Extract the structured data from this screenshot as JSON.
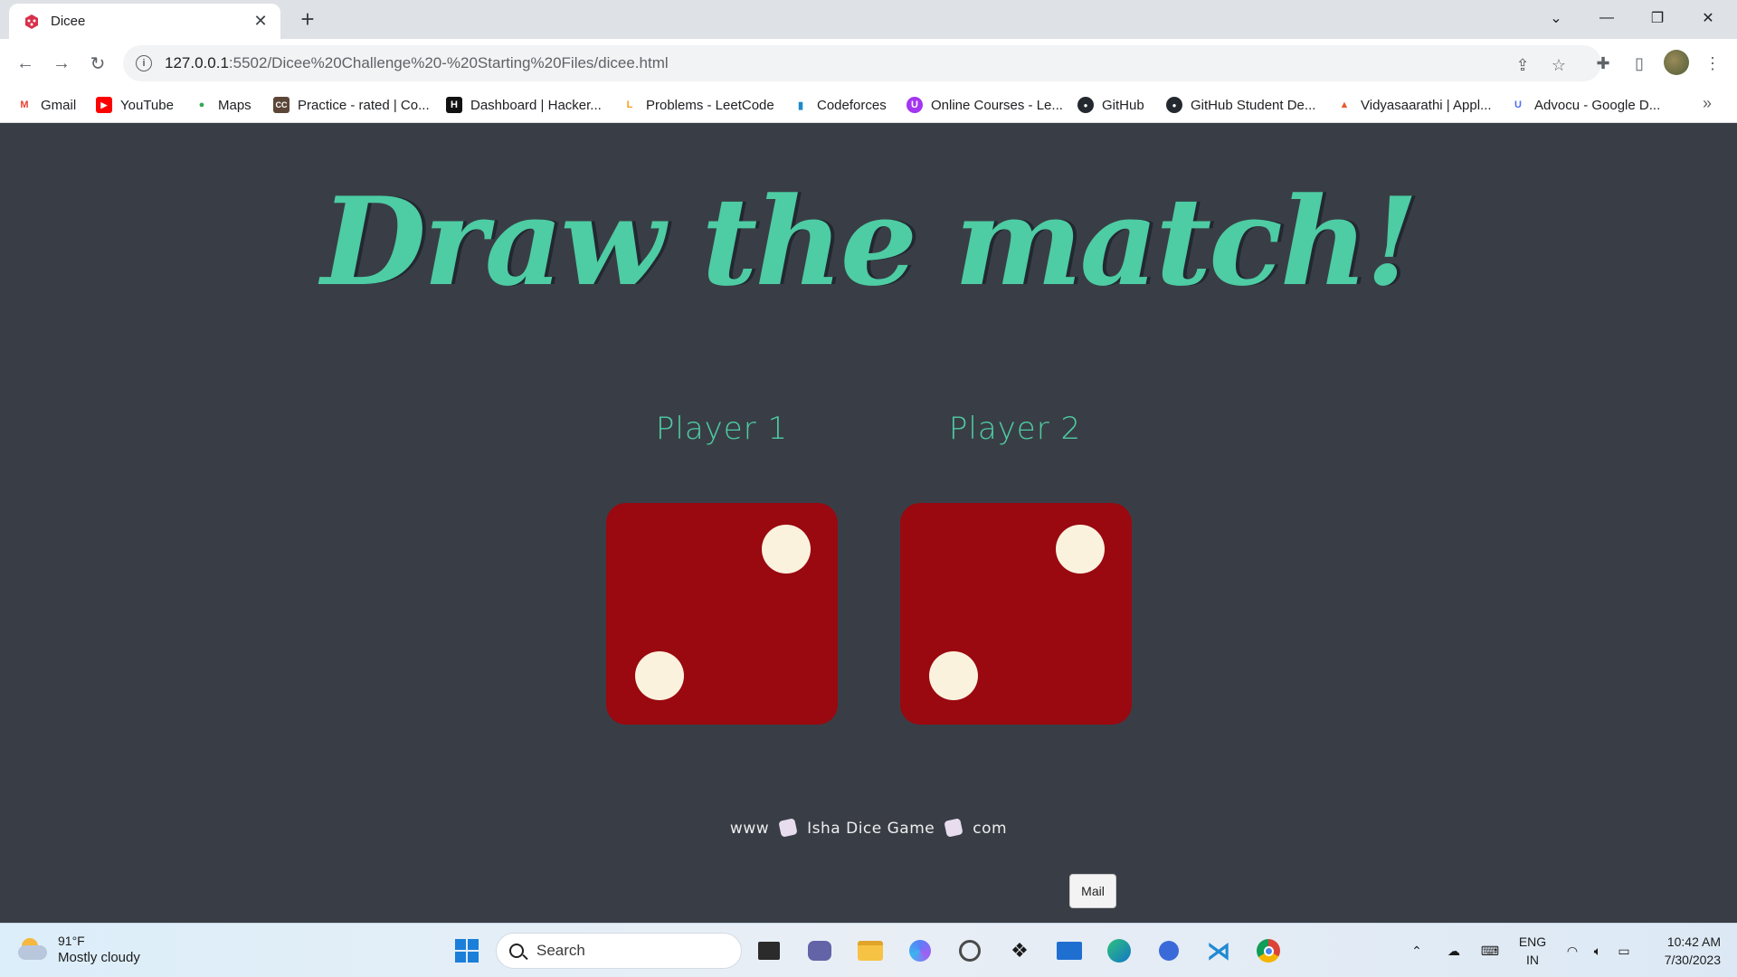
{
  "browser": {
    "tab_title": "Dicee",
    "url_host": "127.0.0.1",
    "url_rest": ":5502/Dicee%20Challenge%20-%20Starting%20Files/dicee.html",
    "bookmarks": [
      {
        "label": "Gmail",
        "icon": "gmail-icon",
        "color": "#ea4335",
        "glyph": "M"
      },
      {
        "label": "YouTube",
        "icon": "youtube-icon",
        "color": "#ff0000",
        "glyph": "▶"
      },
      {
        "label": "Maps",
        "icon": "maps-icon",
        "color": "#34a853",
        "glyph": "●"
      },
      {
        "label": "Practice - rated | Co...",
        "icon": "codechef-icon",
        "color": "#5b4638",
        "glyph": "CC"
      },
      {
        "label": "Dashboard | Hacker...",
        "icon": "hackerrank-icon",
        "color": "#111111",
        "glyph": "H"
      },
      {
        "label": "Problems - LeetCode",
        "icon": "leetcode-icon",
        "color": "#f89f1b",
        "glyph": "L"
      },
      {
        "label": "Codeforces",
        "icon": "codeforces-icon",
        "color": "#1f8acb",
        "glyph": "▮"
      },
      {
        "label": "Online Courses - Le...",
        "icon": "udemy-icon",
        "color": "#a435f0",
        "glyph": "U"
      },
      {
        "label": "GitHub",
        "icon": "github-icon",
        "color": "#24292f",
        "glyph": "●"
      },
      {
        "label": "GitHub Student De...",
        "icon": "github-icon",
        "color": "#24292f",
        "glyph": "●"
      },
      {
        "label": "Vidyasaarathi | Appl...",
        "icon": "vidyasaarathi-icon",
        "color": "#e55b2d",
        "glyph": "▲"
      },
      {
        "label": "Advocu - Google D...",
        "icon": "advocu-icon",
        "color": "#4c6ef5",
        "glyph": "U"
      }
    ]
  },
  "page": {
    "headline": "Draw the match!",
    "player1": "Player 1",
    "player2": "Player 2",
    "dice_values": [
      2,
      2
    ],
    "footer_left": "www",
    "footer_middle": "Isha Dice Game",
    "footer_right": "com",
    "tooltip": "Mail"
  },
  "taskbar": {
    "temperature": "91°F",
    "weather": "Mostly cloudy",
    "search_placeholder": "Search",
    "lang_top": "ENG",
    "lang_bottom": "IN",
    "time": "10:42 AM",
    "date": "7/30/2023"
  },
  "colors": {
    "page_bg": "#393e46",
    "accent": "#4ecca3",
    "die_red": "#9a0810",
    "pip": "#fbf2de"
  }
}
